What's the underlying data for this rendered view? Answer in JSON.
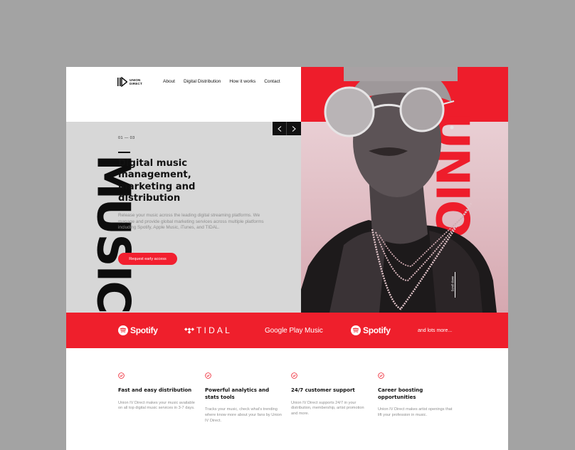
{
  "brand": {
    "logo_line1": "UNION",
    "logo_line2": "DIRECT"
  },
  "nav": [
    {
      "label": "About"
    },
    {
      "label": "Digital Distribution"
    },
    {
      "label": "How it works"
    },
    {
      "label": "Contact"
    }
  ],
  "hero": {
    "counter": "01 — 03",
    "title": "Digital music management, marketing and distribution",
    "description": "Release your music across the leading digital streaming platforms. We manage and provide global marketing services across multiple platforms including Spotify, Apple Music, iTunes, and TIDAL.",
    "cta_label": "Request early access",
    "left_vertical_word": "MUSIC",
    "right_vertical_word": "UNION",
    "scroll_label": "Scroll down"
  },
  "partners": {
    "items": [
      "Spotify",
      "TIDAL",
      "Google Play Music",
      "Spotify"
    ],
    "more_label": "and lots more..."
  },
  "features": [
    {
      "title": "Fast and easy distribution",
      "description": "Union IV Direct makes your music available on all top digital music services in 3-7 days."
    },
    {
      "title": "Powerful analytics and stats tools",
      "description": "Tracks your music, check what's trending where know more about your fans by Union IV Direct."
    },
    {
      "title": "24/7 customer support",
      "description": "Union IV Direct supports 24/7 in your distribution, membership, artist promotion and more."
    },
    {
      "title": "Career boosting opportunities",
      "description": "Union IV Direct makes artist openings that lift your profession in music."
    }
  ],
  "icons": {
    "logo": "play-bars-logo-icon",
    "prev": "chevron-left-icon",
    "next": "chevron-right-icon",
    "feature": "check-circle-icon",
    "spotify": "spotify-icon",
    "tidal": "tidal-icon"
  },
  "colors": {
    "accent": "#ee1d2b",
    "hero_left_bg": "#d7d7d7",
    "outer_bg": "#a3a3a3",
    "text_dark": "#111111"
  }
}
